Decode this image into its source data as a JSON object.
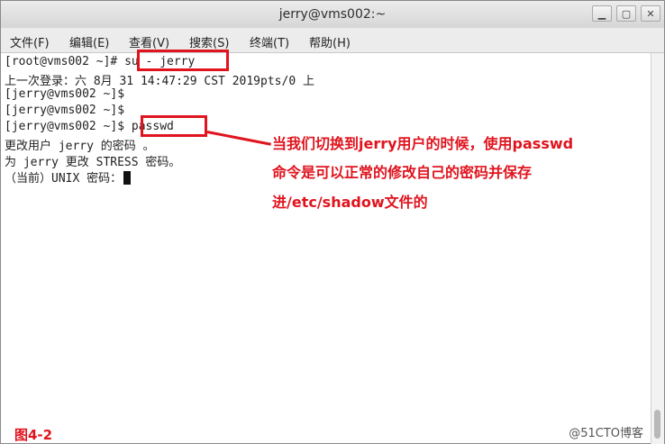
{
  "window": {
    "title": "jerry@vms002:~",
    "controls": {
      "minimize": "▁",
      "maximize": "▢",
      "close": "✕"
    }
  },
  "menu": [
    "文件(F)",
    "编辑(E)",
    "查看(V)",
    "搜索(S)",
    "终端(T)",
    "帮助(H)"
  ],
  "terminal": {
    "lines": [
      {
        "prompt": "[root@vms002 ~]# ",
        "command": "su - jerry"
      },
      {
        "text": "上一次登录：六 8月 31 14:47:29 CST 2019pts/0 上"
      },
      {
        "text": "[jerry@vms002 ~]$"
      },
      {
        "text": "[jerry@vms002 ~]$"
      },
      {
        "prompt": "[jerry@vms002 ~]$ ",
        "command": "passwd"
      },
      {
        "text": "更改用户 jerry 的密码 。"
      },
      {
        "text": "为 jerry 更改 STRESS 密码。"
      },
      {
        "text": "（当前）UNIX 密码："
      }
    ]
  },
  "annotation": {
    "lines": [
      "当我们切换到jerry用户的时候，使用passwd",
      "命令是可以正常的修改自己的密码并保存",
      "进/etc/shadow文件的"
    ],
    "color": "#e0141e"
  },
  "figure_label": "图4-2",
  "watermark": "@51CTO博客"
}
